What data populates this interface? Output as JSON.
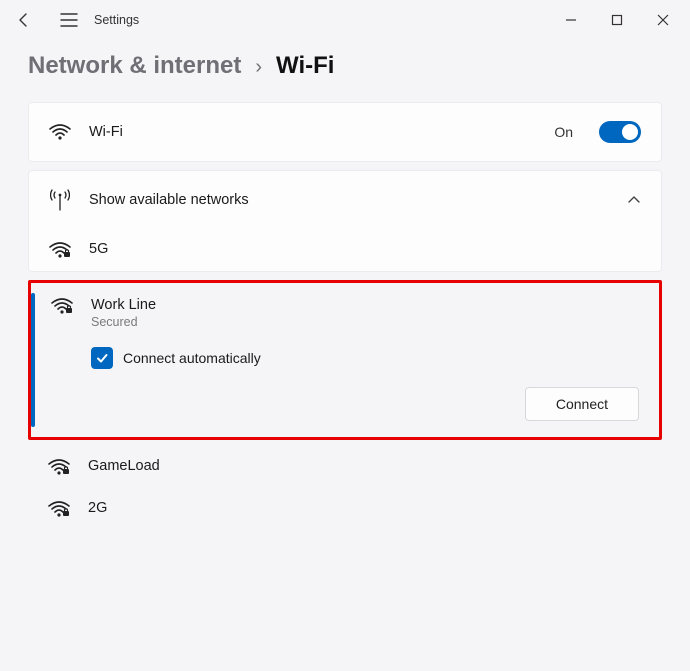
{
  "app_title": "Settings",
  "breadcrumb": {
    "parent": "Network & internet",
    "separator": "›",
    "current": "Wi-Fi"
  },
  "wifi_row": {
    "label": "Wi-Fi",
    "state_label": "On"
  },
  "available": {
    "label": "Show available networks"
  },
  "networks": {
    "n0": {
      "name": "5G"
    },
    "selected": {
      "name": "Work Line",
      "security": "Secured",
      "auto_label": "Connect automatically",
      "connect_label": "Connect"
    },
    "n2": {
      "name": "GameLoad"
    },
    "n3": {
      "name": "2G"
    }
  }
}
